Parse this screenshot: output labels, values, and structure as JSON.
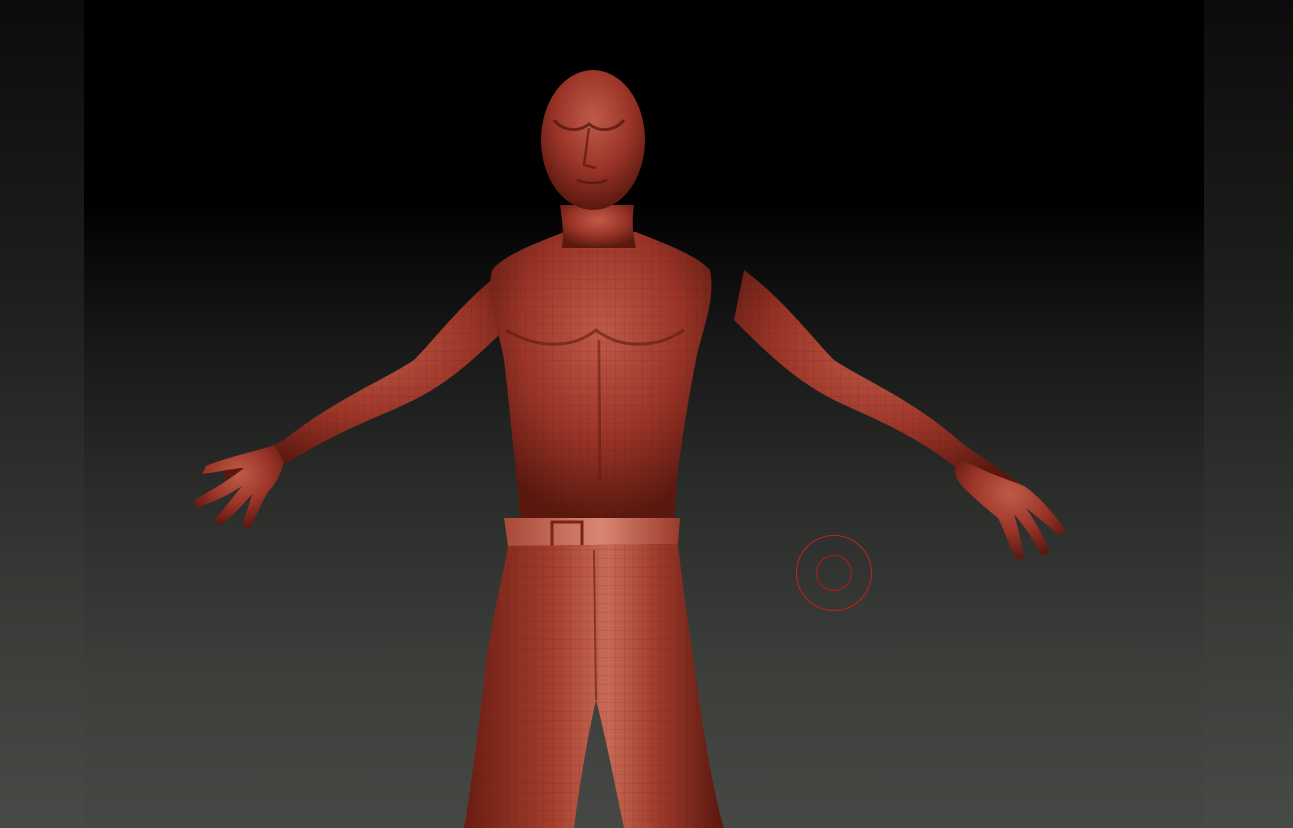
{
  "app": {
    "viewport": "sculpt-canvas"
  },
  "model": {
    "name": "",
    "material_color": "#9b3528",
    "highlight_color": "#c8604e",
    "shadow_color": "#4a130c"
  },
  "brush": {
    "outline_color": "#c8201c",
    "draw_size_visible": true
  },
  "colors": {
    "background_top": "#000000",
    "background_bottom": "#464845",
    "side_panel": "#2a2c29"
  }
}
